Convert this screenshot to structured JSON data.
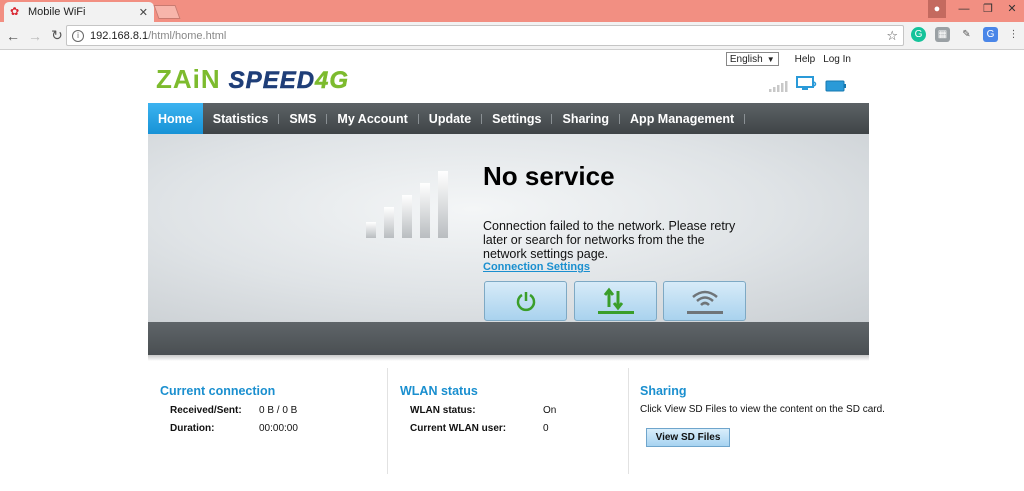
{
  "browser": {
    "tab_title": "Mobile WiFi",
    "tab_close": "✕",
    "url_host": "192.168.8.1",
    "url_path": "/html/home.html"
  },
  "header": {
    "language": "English",
    "help": "Help",
    "login": "Log In",
    "logo_brand": "ZAiN",
    "logo_product_a": "SPEED",
    "logo_product_b": "4G"
  },
  "menu": {
    "items": [
      "Home",
      "Statistics",
      "SMS",
      "My Account",
      "Update",
      "Settings",
      "Sharing",
      "App Management"
    ],
    "active_index": 0
  },
  "hero": {
    "title": "No service",
    "message": "Connection failed to the network. Please retry later or search for networks from the the network settings page.",
    "link": "Connection Settings",
    "signal_level": 0
  },
  "current_connection": {
    "title": "Current connection",
    "received_sent_label": "Received/Sent:",
    "received_sent_value": "0 B /  0 B",
    "duration_label": "Duration:",
    "duration_value": "00:00:00"
  },
  "wlan": {
    "title": "WLAN status",
    "status_label": "WLAN status:",
    "status_value": "On",
    "users_label": "Current WLAN user:",
    "users_value": "0"
  },
  "sharing": {
    "title": "Sharing",
    "description": "Click View SD Files to view the content on the SD card.",
    "button": "View SD Files"
  },
  "colors": {
    "accent": "#1a8fcf",
    "menu_active": "#2aa3e3",
    "logo_green": "#7dbb2e",
    "logo_blue": "#1f3e78"
  }
}
